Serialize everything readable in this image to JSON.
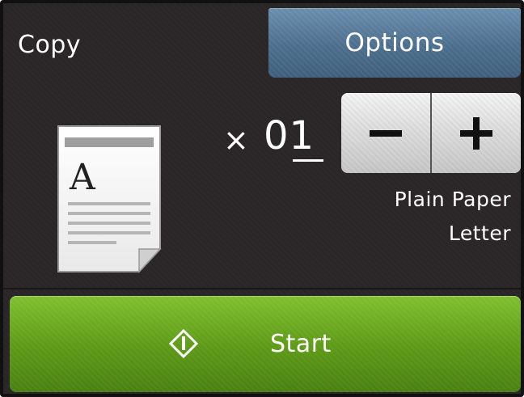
{
  "header": {
    "title": "Copy",
    "options_label": "Options"
  },
  "copies": {
    "prefix": "×",
    "count": "01"
  },
  "paper": {
    "type": "Plain Paper",
    "size": "Letter"
  },
  "start": {
    "label": "Start"
  },
  "preview": {
    "letter": "A"
  },
  "colors": {
    "background": "#2a2627",
    "options_button": "#4c6e8d",
    "stepper_button": "#dcdcdc",
    "start_button": "#5f9c18",
    "text": "#ffffff"
  },
  "icons": {
    "document": "document-preview-icon",
    "minus": "minus-icon",
    "plus": "plus-icon",
    "start": "start-diamond-icon"
  }
}
